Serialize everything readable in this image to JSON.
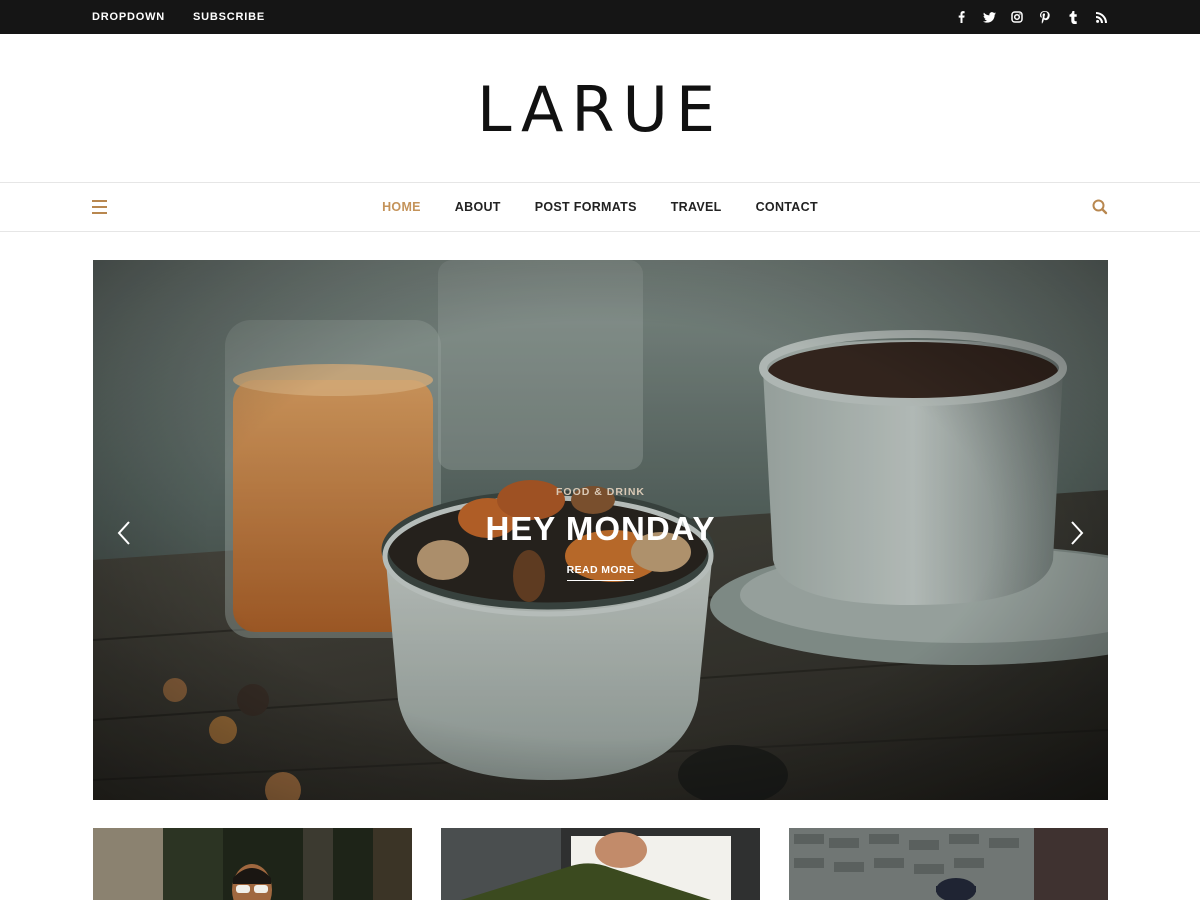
{
  "topbar": {
    "links": [
      "DROPDOWN",
      "SUBSCRIBE"
    ],
    "social_icons": [
      "facebook-icon",
      "twitter-icon",
      "instagram-icon",
      "pinterest-icon",
      "tumblr-icon",
      "rss-icon"
    ]
  },
  "site": {
    "title": "LARUE"
  },
  "nav": {
    "items": [
      {
        "label": "HOME",
        "active": true
      },
      {
        "label": "ABOUT",
        "active": false
      },
      {
        "label": "POST FORMATS",
        "active": false
      },
      {
        "label": "TRAVEL",
        "active": false
      },
      {
        "label": "CONTACT",
        "active": false
      }
    ],
    "menu_icon": "hamburger-menu-icon",
    "search_icon": "search-icon"
  },
  "slider": {
    "category": "FOOD & DRINK",
    "title": "HEY MONDAY",
    "read_more": "READ MORE",
    "prev_icon": "chevron-left-icon",
    "next_icon": "chevron-right-icon"
  },
  "colors": {
    "accent": "#c4935a",
    "topbar_bg": "#151515",
    "text": "#222222"
  }
}
